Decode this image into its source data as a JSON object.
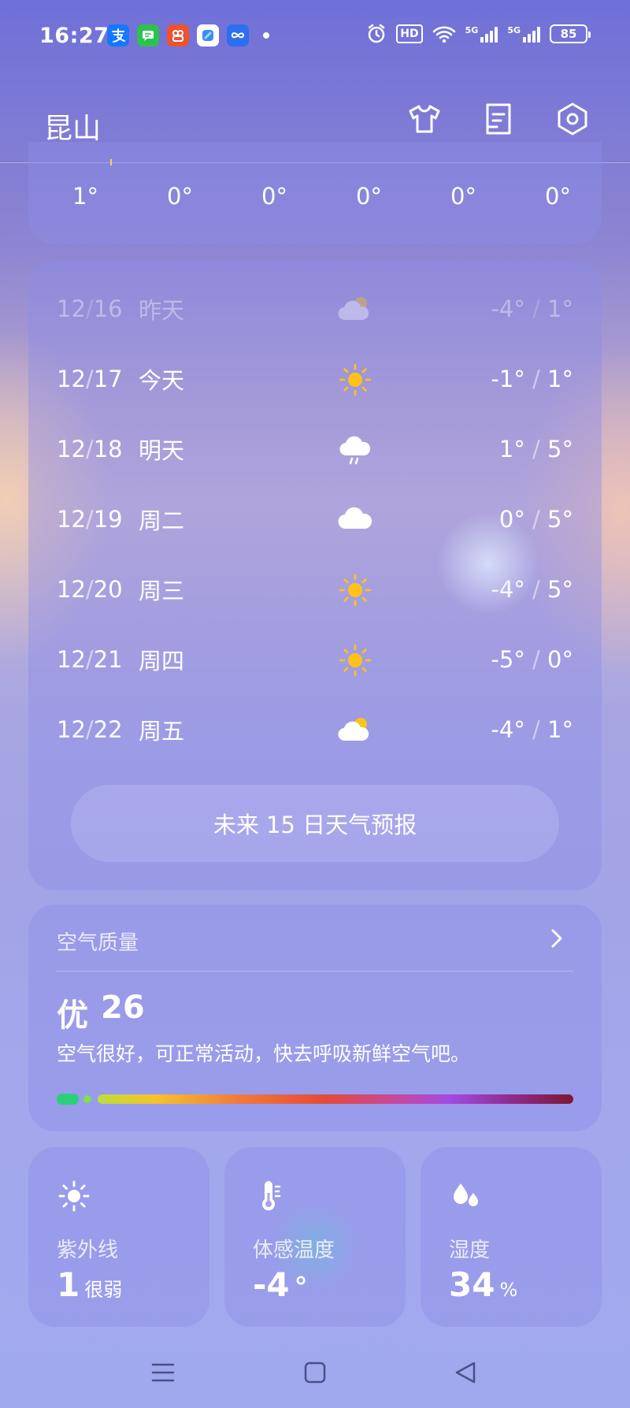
{
  "status_bar": {
    "time": "16:27",
    "hd_label": "HD",
    "net1": "5G",
    "net2": "5G",
    "battery": "85"
  },
  "header": {
    "city": "昆山",
    "icons": [
      "shirt-icon",
      "document-icon",
      "settings-icon"
    ]
  },
  "hourly": {
    "temps": [
      "1°",
      "0°",
      "0°",
      "0°",
      "0°",
      "0°"
    ]
  },
  "daily": {
    "rows": [
      {
        "date_m": "12",
        "date_d": "16",
        "day": "昨天",
        "icon": "partly-cloudy-icon",
        "low": "-4°",
        "high": "1°",
        "past": true
      },
      {
        "date_m": "12",
        "date_d": "17",
        "day": "今天",
        "icon": "sunny-icon",
        "low": "-1°",
        "high": "1°"
      },
      {
        "date_m": "12",
        "date_d": "18",
        "day": "明天",
        "icon": "rain-icon",
        "low": "1°",
        "high": "5°"
      },
      {
        "date_m": "12",
        "date_d": "19",
        "day": "周二",
        "icon": "cloudy-icon",
        "low": "0°",
        "high": "5°"
      },
      {
        "date_m": "12",
        "date_d": "20",
        "day": "周三",
        "icon": "sunny-icon",
        "low": "-4°",
        "high": "5°"
      },
      {
        "date_m": "12",
        "date_d": "21",
        "day": "周四",
        "icon": "sunny-icon",
        "low": "-5°",
        "high": "0°"
      },
      {
        "date_m": "12",
        "date_d": "22",
        "day": "周五",
        "icon": "partly-cloudy-icon",
        "low": "-4°",
        "high": "1°"
      }
    ],
    "more_label": "未来 15 日天气预报"
  },
  "air_quality": {
    "title": "空气质量",
    "level": "优",
    "aqi": "26",
    "description": "空气很好，可正常活动，快去呼吸新鲜空气吧。"
  },
  "uv": {
    "label": "紫外线",
    "value": "1",
    "unit": "很弱"
  },
  "feels_like": {
    "label": "体感温度",
    "value": "-4",
    "unit": "°"
  },
  "humidity": {
    "label": "湿度",
    "value": "34",
    "unit": "%"
  },
  "colors": {
    "sun": "#ffc21a",
    "aqi_good": "#2ad07a"
  }
}
